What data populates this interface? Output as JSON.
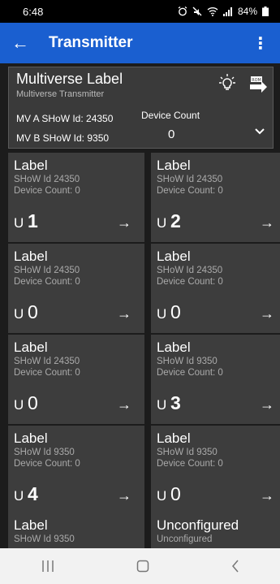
{
  "status": {
    "time": "6:48",
    "battery": "84%"
  },
  "appbar": {
    "title": "Transmitter"
  },
  "header": {
    "label": "Multiverse Label",
    "subtitle": "Multiverse Transmitter",
    "mv_a": "MV A SHoW Id: 24350",
    "mv_b": "MV B SHoW Id: 9350",
    "device_count_label": "Device Count",
    "device_count": "0"
  },
  "tiles": [
    {
      "label": "Label",
      "show": "SHoW Id 24350",
      "count": "Device Count: 0",
      "u": "U",
      "num": "1"
    },
    {
      "label": "Label",
      "show": "SHoW Id 24350",
      "count": "Device Count: 0",
      "u": "U",
      "num": "2"
    },
    {
      "label": "Label",
      "show": "SHoW Id 24350",
      "count": "Device Count: 0",
      "u": "U",
      "num": "0"
    },
    {
      "label": "Label",
      "show": "SHoW Id 24350",
      "count": "Device Count: 0",
      "u": "U",
      "num": "0"
    },
    {
      "label": "Label",
      "show": "SHoW Id 24350",
      "count": "Device Count: 0",
      "u": "U",
      "num": "0"
    },
    {
      "label": "Label",
      "show": "SHoW Id 9350",
      "count": "Device Count: 0",
      "u": "U",
      "num": "3"
    },
    {
      "label": "Label",
      "show": "SHoW Id 9350",
      "count": "Device Count: 0",
      "u": "U",
      "num": "4"
    },
    {
      "label": "Label",
      "show": "SHoW Id 9350",
      "count": "Device Count: 0",
      "u": "U",
      "num": "0"
    },
    {
      "label": "Label",
      "show": "SHoW Id 9350"
    },
    {
      "label": "Unconfigured",
      "show": "Unconfigured"
    }
  ]
}
